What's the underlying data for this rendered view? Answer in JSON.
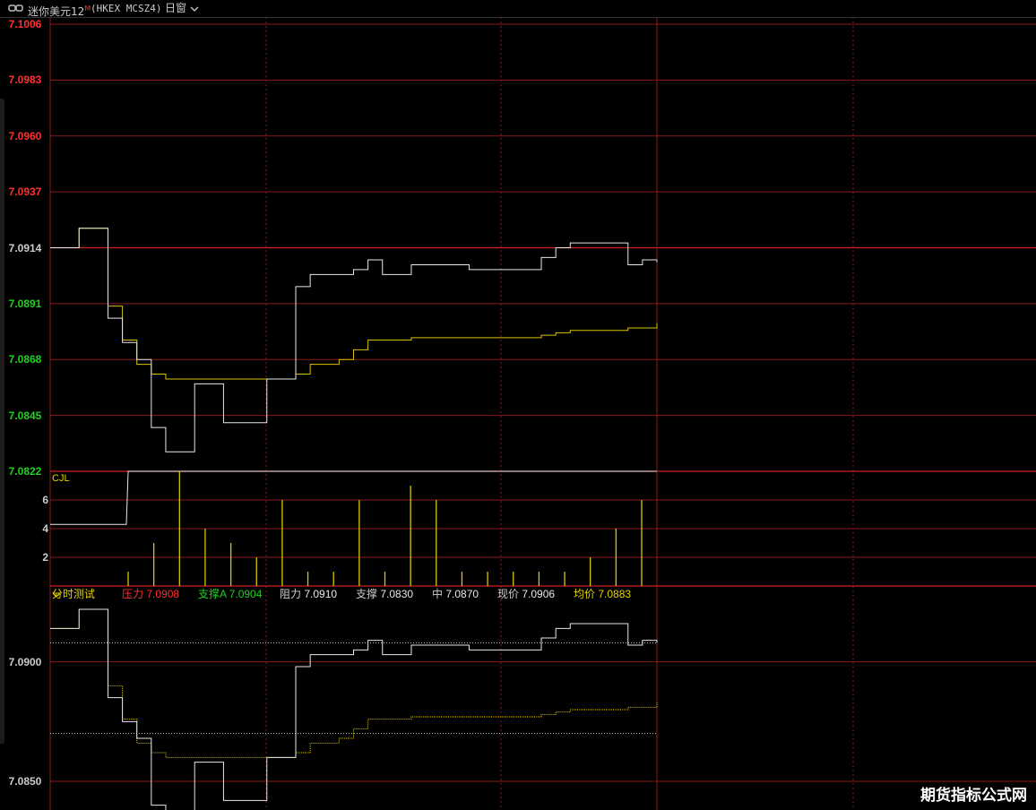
{
  "header": {
    "title": "迷你美元12",
    "title_sup": "M",
    "code": "(HKEX MCSZ4)",
    "period": "日窗",
    "period_icon": "chevron-down-icon"
  },
  "colors": {
    "background": "#000000",
    "grid_red": "#8b1a1a",
    "baseline_red": "#d42020",
    "price_line": "#e8e8e8",
    "avg_line": "#d9c400",
    "up_text": "#ff3030",
    "down_text": "#22d022",
    "neutral_text": "#cccccc"
  },
  "price_axis": {
    "labels": [
      "7.1006",
      "7.0983",
      "7.0960",
      "7.0937",
      "7.0914",
      "7.0891",
      "7.0868",
      "7.0845",
      "7.0822"
    ],
    "label_colors": [
      "#ff3030",
      "#ff3030",
      "#ff3030",
      "#ff3030",
      "#cccccc",
      "#22d022",
      "#22d022",
      "#22d022",
      "#22d022"
    ]
  },
  "volume_panel": {
    "name": "CJL",
    "ticks": [
      "6",
      "4",
      "2"
    ]
  },
  "indicator_panel": {
    "name": "分时测试",
    "items": [
      {
        "label": "压力",
        "value": "7.0908",
        "label_color": "#ff3030",
        "value_color": "#ff3030"
      },
      {
        "label": "支撑A",
        "value": "7.0904",
        "label_color": "#22d022",
        "value_color": "#22d022"
      },
      {
        "label": "阻力",
        "value": "7.0910",
        "label_color": "#cccccc",
        "value_color": "#e8e8e8"
      },
      {
        "label": "支撑",
        "value": "7.0830",
        "label_color": "#cccccc",
        "value_color": "#e8e8e8"
      },
      {
        "label": "中",
        "value": "7.0870",
        "label_color": "#cccccc",
        "value_color": "#e8e8e8"
      },
      {
        "label": "现价",
        "value": "7.0906",
        "label_color": "#cccccc",
        "value_color": "#e8e8e8"
      },
      {
        "label": "均价",
        "value": "7.0883",
        "label_color": "#e6d200",
        "value_color": "#e6d200"
      }
    ],
    "axis_labels": [
      "7.0900",
      "7.0850"
    ]
  },
  "watermark": "期货指标公式网",
  "chart_data": [
    {
      "type": "line",
      "panel": "price",
      "ylim": [
        7.0822,
        7.1006
      ],
      "reference": 7.0914,
      "series": [
        {
          "values": [
            7.0914,
            7.0914,
            7.0922,
            7.0922,
            7.0885,
            7.0875,
            7.0868,
            7.084,
            7.083,
            7.083,
            7.0858,
            7.0858,
            7.0842,
            7.0842,
            7.0842,
            7.086,
            7.086,
            7.0898,
            7.0903,
            7.0903,
            7.0903,
            7.0905,
            7.0909,
            7.0903,
            7.0903,
            7.0907,
            7.0907,
            7.0907,
            7.0907,
            7.0905,
            7.0905,
            7.0905,
            7.0905,
            7.0905,
            7.091,
            7.0914,
            7.0916,
            7.0916,
            7.0916,
            7.0916,
            7.0907,
            7.0909,
            7.0908
          ]
        },
        {
          "values": [
            7.0914,
            7.0914,
            7.0922,
            7.0922,
            7.089,
            7.0876,
            7.0866,
            7.0862,
            7.086,
            7.086,
            7.086,
            7.086,
            7.086,
            7.086,
            7.086,
            7.086,
            7.086,
            7.0862,
            7.0866,
            7.0866,
            7.0868,
            7.0872,
            7.0876,
            7.0876,
            7.0876,
            7.0877,
            7.0877,
            7.0877,
            7.0877,
            7.0877,
            7.0877,
            7.0877,
            7.0877,
            7.0877,
            7.0878,
            7.0879,
            7.088,
            7.088,
            7.088,
            7.088,
            7.0881,
            7.0881,
            7.0883
          ]
        }
      ]
    },
    {
      "type": "bar",
      "panel": "volume",
      "name": "CJL",
      "ylim": [
        0,
        8
      ],
      "values": [
        1,
        3,
        8,
        4,
        3,
        2,
        6,
        1,
        1,
        6,
        1,
        7,
        6,
        1,
        1,
        1,
        1,
        1,
        2,
        4,
        6
      ]
    },
    {
      "type": "line",
      "panel": "indicator",
      "ylim": [
        7.0838,
        7.0925
      ],
      "levels": [
        7.0908,
        7.087,
        7.083
      ],
      "series": [
        {
          "values": [
            7.0914,
            7.0914,
            7.0922,
            7.0922,
            7.0885,
            7.0875,
            7.0868,
            7.084,
            7.083,
            7.083,
            7.0858,
            7.0858,
            7.0842,
            7.0842,
            7.0842,
            7.086,
            7.086,
            7.0898,
            7.0903,
            7.0903,
            7.0903,
            7.0905,
            7.0909,
            7.0903,
            7.0903,
            7.0907,
            7.0907,
            7.0907,
            7.0907,
            7.0905,
            7.0905,
            7.0905,
            7.0905,
            7.0905,
            7.091,
            7.0914,
            7.0916,
            7.0916,
            7.0916,
            7.0916,
            7.0907,
            7.0909,
            7.0908
          ]
        },
        {
          "values": [
            7.0914,
            7.0914,
            7.0922,
            7.0922,
            7.089,
            7.0876,
            7.0866,
            7.0862,
            7.086,
            7.086,
            7.086,
            7.086,
            7.086,
            7.086,
            7.086,
            7.086,
            7.086,
            7.0862,
            7.0866,
            7.0866,
            7.0868,
            7.0872,
            7.0876,
            7.0876,
            7.0876,
            7.0877,
            7.0877,
            7.0877,
            7.0877,
            7.0877,
            7.0877,
            7.0877,
            7.0877,
            7.0877,
            7.0878,
            7.0879,
            7.088,
            7.088,
            7.088,
            7.088,
            7.0881,
            7.0881,
            7.0883
          ]
        }
      ]
    }
  ]
}
